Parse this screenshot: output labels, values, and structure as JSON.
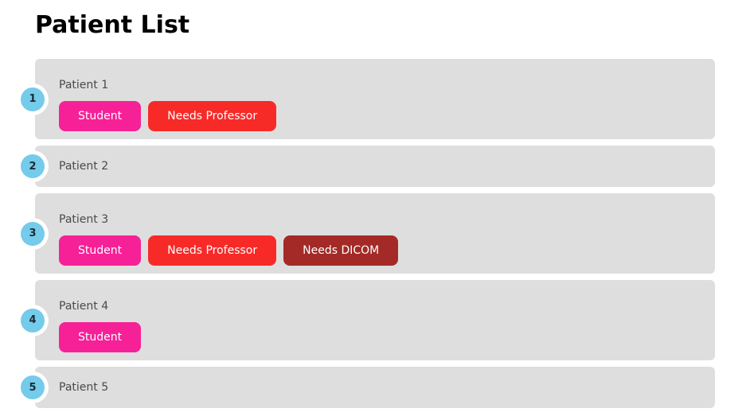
{
  "page": {
    "title": "Patient List"
  },
  "tag_colors": {
    "student": "#f72197",
    "needs_professor": "#f72a28",
    "needs_dicom": "#a32a26"
  },
  "theme": {
    "card_background": "#dedede",
    "badge_background": "#74cbea",
    "page_background": "#ffffff",
    "name_text": "#4a4a4a",
    "title_text": "#000000"
  },
  "patients": [
    {
      "badge": "1",
      "name": "Patient 1",
      "tags": [
        {
          "label": "Student",
          "style": "student"
        },
        {
          "label": "Needs Professor",
          "style": "needsprofessor"
        }
      ]
    },
    {
      "badge": "2",
      "name": "Patient 2",
      "tags": []
    },
    {
      "badge": "3",
      "name": "Patient 3",
      "tags": [
        {
          "label": "Student",
          "style": "student"
        },
        {
          "label": "Needs Professor",
          "style": "needsprofessor"
        },
        {
          "label": "Needs DICOM",
          "style": "needsdicom"
        }
      ]
    },
    {
      "badge": "4",
      "name": "Patient 4",
      "tags": [
        {
          "label": "Student",
          "style": "student"
        }
      ]
    },
    {
      "badge": "5",
      "name": "Patient 5",
      "tags": []
    }
  ]
}
